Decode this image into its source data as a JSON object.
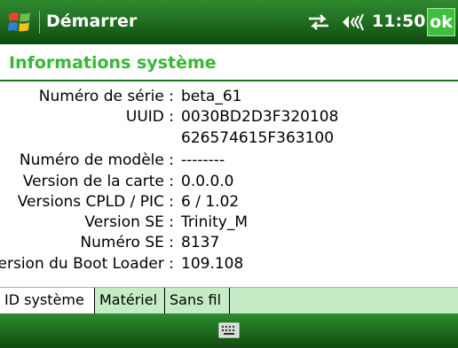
{
  "titlebar": {
    "title": "Démarrer",
    "time": "11:50",
    "ok_label": "ok",
    "icons": [
      "windows-start-icon",
      "connectivity-icon",
      "volume-icon"
    ]
  },
  "page": {
    "title": "Informations système"
  },
  "info_rows": [
    {
      "label": "Numéro de série :",
      "value": "beta_61"
    },
    {
      "label": "UUID :",
      "value": "0030BD2D3F320108"
    },
    {
      "label": "",
      "value": "626574615F363100"
    },
    {
      "label": "Numéro de modèle :",
      "value": "--------"
    },
    {
      "label": "Version de la carte :",
      "value": "0.0.0.0"
    },
    {
      "label": "Versions CPLD / PIC :",
      "value": "6 / 1.02"
    },
    {
      "label": "Version SE :",
      "value": "Trinity_M"
    },
    {
      "label": "Numéro SE :",
      "value": "8137"
    },
    {
      "label": "Version du Boot Loader :",
      "value": "109.108"
    }
  ],
  "tabs": [
    {
      "label": "ID système",
      "active": true
    },
    {
      "label": "Matériel",
      "active": false
    },
    {
      "label": "Sans fil",
      "active": false
    }
  ],
  "bottombar": {
    "icons": [
      "keyboard-icon"
    ]
  },
  "colors": {
    "bar_green": "#1e6a1e",
    "title_green": "#37b837",
    "tab_bg": "#c6ecc6",
    "ok_green": "#3fbf3f"
  }
}
